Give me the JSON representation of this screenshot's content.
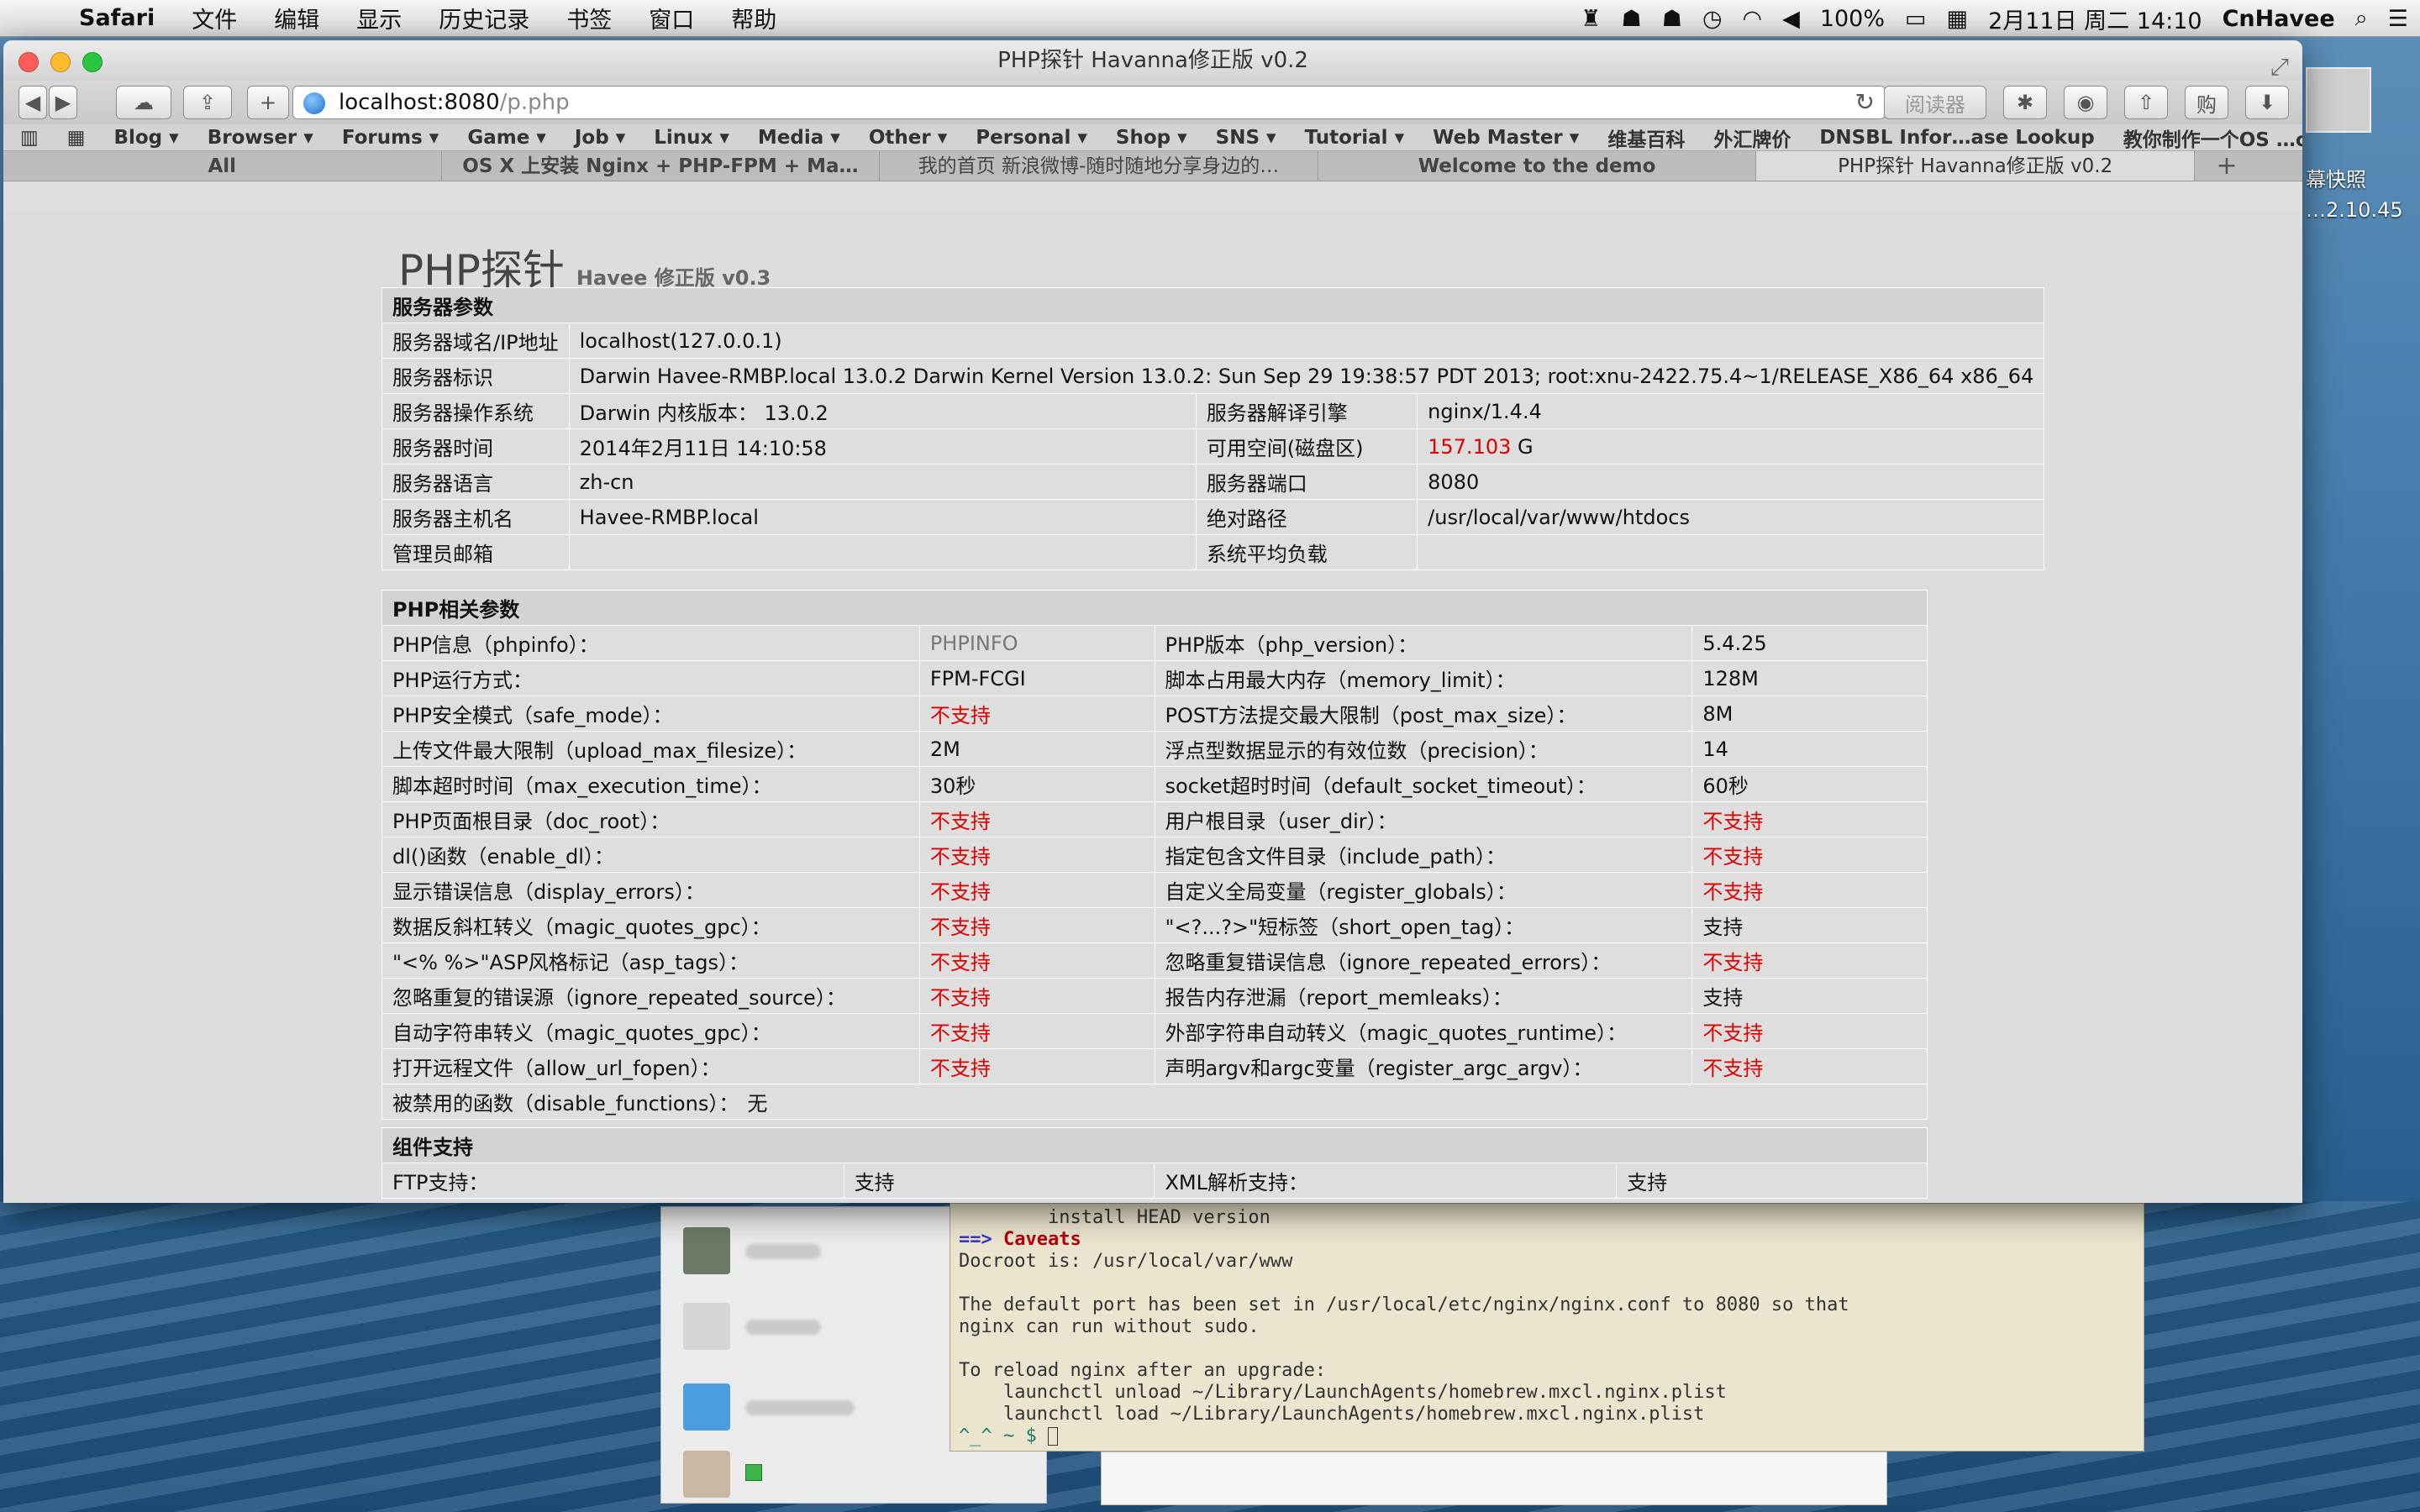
{
  "menubar": {
    "app": "Safari",
    "menus": [
      "文件",
      "编辑",
      "显示",
      "历史记录",
      "书签",
      "窗口",
      "帮助"
    ],
    "battery": "100%",
    "date": "2月11日 周二 14:10",
    "user": "CnHavee"
  },
  "desktop": {
    "label1": "幕快照",
    "label2": "…2.10.45"
  },
  "window": {
    "title": "PHP探针 Havanna修正版 v0.2",
    "url_host": "localhost:8080",
    "url_path": "/p.php",
    "reader": "阅读器",
    "bookmarks": [
      "Blog ▾",
      "Browser ▾",
      "Forums ▾",
      "Game ▾",
      "Job ▾",
      "Linux ▾",
      "Media ▾",
      "Other ▾",
      "Personal ▾",
      "Shop ▾",
      "SNS ▾",
      "Tutorial ▾",
      "Web Master ▾",
      "维基百科",
      "外汇牌价",
      "DNSBL Infor…ase Lookup",
      "教你制作一个OS …ok Pro -"
    ],
    "tabs": [
      "All",
      "OS X 上安装 Nginx + PHP-FPM + Ma…",
      "我的首页 新浪微博-随时随地分享身边的…",
      "Welcome to the demo",
      "PHP探针 Havanna修正版 v0.2"
    ]
  },
  "page": {
    "title": "PHP探针",
    "subtitle": "Havee 修正版 v0.3",
    "server": {
      "header": "服务器参数",
      "domain_label": "服务器域名/IP地址",
      "domain_value": "localhost(127.0.0.1)",
      "ident_label": "服务器标识",
      "ident_value": "Darwin Havee-RMBP.local 13.0.2 Darwin Kernel Version 13.0.2: Sun Sep 29 19:38:57 PDT 2013; root:xnu-2422.75.4~1/RELEASE_X86_64 x86_64",
      "rows": [
        {
          "l1": "服务器操作系统",
          "v1": "Darwin  内核版本： 13.0.2",
          "l2": "服务器解译引擎",
          "v2": "nginx/1.4.4"
        },
        {
          "l1": "服务器时间",
          "v1": "2014年2月11日 14:10:58",
          "l2": "可用空间(磁盘区)",
          "v2": "157.103",
          "v2_unit": " G"
        },
        {
          "l1": "服务器语言",
          "v1": "zh-cn",
          "l2": "服务器端口",
          "v2": "8080"
        },
        {
          "l1": "服务器主机名",
          "v1": "Havee-RMBP.local",
          "l2": "绝对路径",
          "v2": "/usr/local/var/www/htdocs"
        },
        {
          "l1": "管理员邮箱",
          "v1": "",
          "l2": "系统平均负载",
          "v2": ""
        }
      ]
    },
    "php": {
      "header": "PHP相关参数",
      "rows": [
        {
          "l1": "PHP信息（phpinfo）：",
          "v1": "PHPINFO",
          "l2": "PHP版本（php_version）：",
          "v2": "5.4.25"
        },
        {
          "l1": "PHP运行方式：",
          "v1": "FPM-FCGI",
          "l2": "脚本占用最大内存（memory_limit）：",
          "v2": "128M"
        },
        {
          "l1": "PHP安全模式（safe_mode）：",
          "v1": "不支持",
          "l2": "POST方法提交最大限制（post_max_size）：",
          "v2": "8M"
        },
        {
          "l1": "上传文件最大限制（upload_max_filesize）：",
          "v1": "2M",
          "l2": "浮点型数据显示的有效位数（precision）：",
          "v2": "14"
        },
        {
          "l1": "脚本超时时间（max_execution_time）：",
          "v1": "30秒",
          "l2": "socket超时时间（default_socket_timeout）：",
          "v2": "60秒"
        },
        {
          "l1": "PHP页面根目录（doc_root）：",
          "v1": "不支持",
          "l2": "用户根目录（user_dir）：",
          "v2": "不支持"
        },
        {
          "l1": "dl()函数（enable_dl）：",
          "v1": "不支持",
          "l2": "指定包含文件目录（include_path）：",
          "v2": "不支持"
        },
        {
          "l1": "显示错误信息（display_errors）：",
          "v1": "不支持",
          "l2": "自定义全局变量（register_globals）：",
          "v2": "不支持"
        },
        {
          "l1": "数据反斜杠转义（magic_quotes_gpc）：",
          "v1": "不支持",
          "l2": "\"<?...?>\"短标签（short_open_tag）：",
          "v2": "支持"
        },
        {
          "l1": "\"<% %>\"ASP风格标记（asp_tags）：",
          "v1": "不支持",
          "l2": "忽略重复错误信息（ignore_repeated_errors）：",
          "v2": "不支持"
        },
        {
          "l1": "忽略重复的错误源（ignore_repeated_source）：",
          "v1": "不支持",
          "l2": "报告内存泄漏（report_memleaks）：",
          "v2": "支持"
        },
        {
          "l1": "自动字符串转义（magic_quotes_gpc）：",
          "v1": "不支持",
          "l2": "外部字符串自动转义（magic_quotes_runtime）：",
          "v2": "不支持"
        },
        {
          "l1": "打开远程文件（allow_url_fopen）：",
          "v1": "不支持",
          "l2": "声明argv和argc变量（register_argc_argv）：",
          "v2": "不支持"
        }
      ],
      "disabled_label": "被禁用的函数（disable_functions）：",
      "disabled_value": "无"
    },
    "components": {
      "header": "组件支持",
      "rows": [
        {
          "l1": "FTP支持：",
          "v1": "支持",
          "l2": "XML解析支持：",
          "v2": "支持"
        }
      ]
    }
  },
  "terminal": {
    "lines": [
      {
        "t": "        install HEAD version",
        "c": ""
      },
      {
        "t": "==> ",
        "c": "arrow",
        "t2": "Caveats",
        "c2": "cav"
      },
      {
        "t": "Docroot is: /usr/local/var/www",
        "c": ""
      },
      {
        "t": "",
        "c": ""
      },
      {
        "t": "The default port has been set in /usr/local/etc/nginx/nginx.conf to 8080 so that",
        "c": ""
      },
      {
        "t": "nginx can run without sudo.",
        "c": ""
      },
      {
        "t": "",
        "c": ""
      },
      {
        "t": "To reload nginx after an upgrade:",
        "c": ""
      },
      {
        "t": "    launchctl unload ~/Library/LaunchAgents/homebrew.mxcl.nginx.plist",
        "c": ""
      },
      {
        "t": "    launchctl load ~/Library/LaunchAgents/homebrew.mxcl.nginx.plist",
        "c": ""
      },
      {
        "t": "^_^ ~ $ ",
        "c": "prompt"
      }
    ]
  }
}
